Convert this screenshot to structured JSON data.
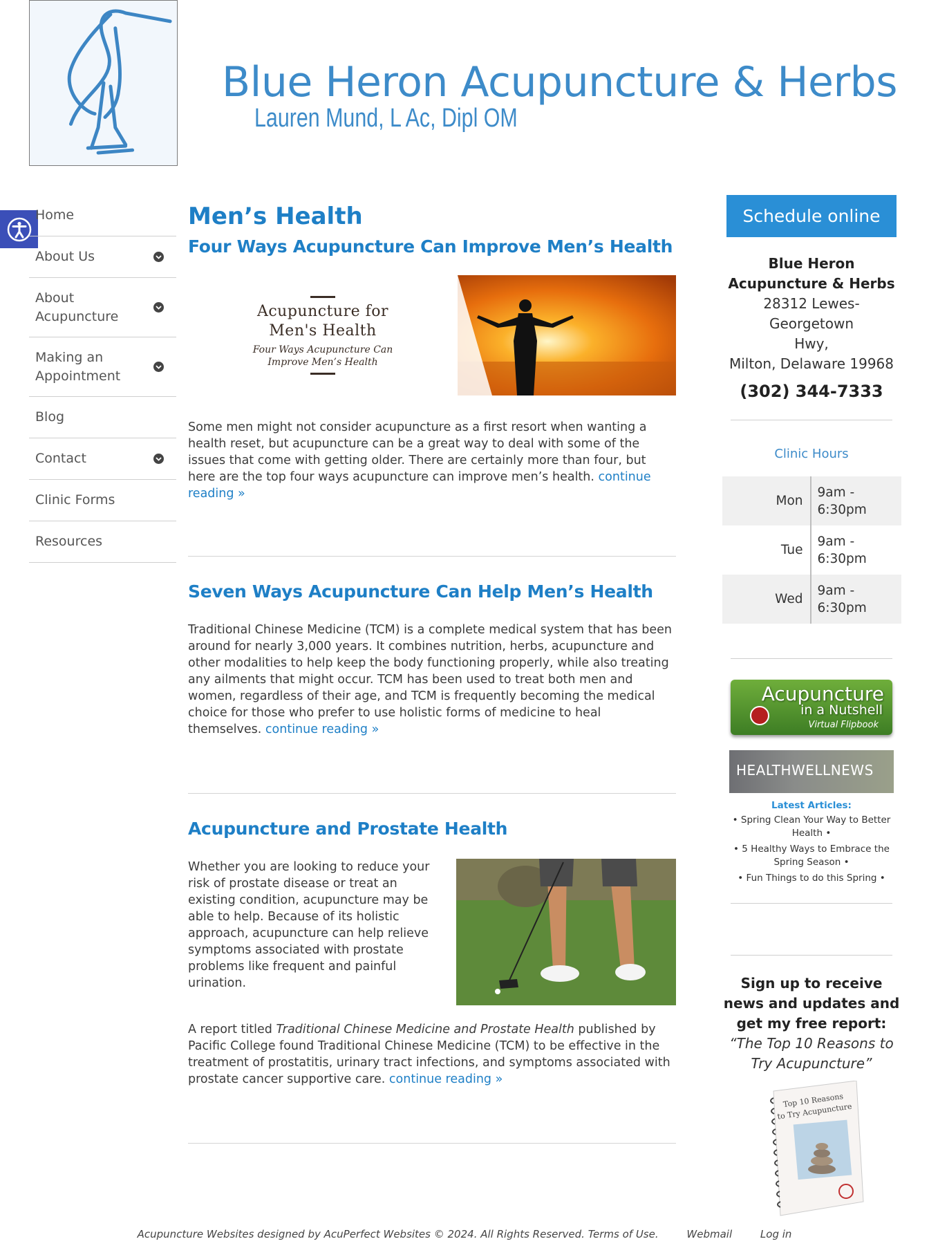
{
  "header": {
    "title": "Blue Heron Acupuncture & Herbs",
    "subtitle": "Lauren Mund, L Ac, Dipl OM"
  },
  "accessibility": {
    "icon": "accessibility-icon"
  },
  "nav": {
    "items": [
      {
        "label": "Home",
        "has_submenu": false
      },
      {
        "label": "About Us",
        "has_submenu": true
      },
      {
        "label": "About\nAcupuncture",
        "has_submenu": true
      },
      {
        "label": "Making an\nAppointment",
        "has_submenu": true
      },
      {
        "label": "Blog",
        "has_submenu": false
      },
      {
        "label": "Contact",
        "has_submenu": true
      },
      {
        "label": "Clinic Forms",
        "has_submenu": false
      },
      {
        "label": "Resources",
        "has_submenu": false
      }
    ]
  },
  "main": {
    "page_title": "Men’s Health",
    "posts": [
      {
        "title": "Four Ways Acupuncture Can Improve Men’s Health",
        "banner_heading": "Acupuncture for\nMen's Health",
        "banner_sub": "Four Ways Acupuncture Can\nImprove Men’s Health",
        "text": "Some men might not consider acupuncture as a first resort when wanting a health reset, but acupuncture can be a great way to deal with some of the issues that come with getting older. There are certainly more than four, but here are the top four ways acupuncture can improve men’s health.",
        "more": "continue reading »"
      },
      {
        "title": "Seven Ways Acupuncture Can Help Men’s Health",
        "text": "Traditional Chinese Medicine (TCM) is a complete medical system that has been around for nearly 3,000 years. It combines nutrition, herbs, acupuncture and other modalities to help keep the body functioning properly, while also treating any ailments that might occur. TCM has been used to treat both men and women, regardless of their age, and TCM is frequently becoming the medical choice for those who prefer to use holistic forms of medicine to heal themselves.",
        "more": "continue reading »"
      },
      {
        "title": "Acupuncture and Prostate Health",
        "text": "Whether you are looking to reduce your risk of prostate disease or treat an existing condition, acupuncture may be able to help. Because of its holistic approach, acupuncture can help relieve symptoms associated with prostate problems like frequent and painful urination.",
        "text2_prefix": "A report titled ",
        "text2_italic": "Traditional Chinese Medicine and Prostate Health",
        "text2_suffix": " published by Pacific College found Traditional Chinese Medicine (TCM) to be effective in the treatment of prostatitis, urinary tract infections, and symptoms associated with prostate cancer supportive care.",
        "more": "continue reading »"
      }
    ]
  },
  "sidebar": {
    "schedule_button": "Schedule online",
    "business_name": "Blue Heron\nAcupuncture & Herbs",
    "address": "28312 Lewes-Georgetown\nHwy,\nMilton, Delaware 19968",
    "phone": "(302) 344-7333",
    "hours_title": "Clinic Hours",
    "hours": [
      {
        "day": "Mon",
        "time": "9am -\n6:30pm"
      },
      {
        "day": "Tue",
        "time": "9am -\n6:30pm"
      },
      {
        "day": "Wed",
        "time": "9am -\n6:30pm"
      }
    ],
    "flipbook": {
      "line1": "Acupuncture",
      "line2": "in a Nutshell",
      "line3": "Virtual Flipbook"
    },
    "healthwell": {
      "logo_text": "HEALTHWELLNEWS",
      "latest_label": "Latest Articles:"
    },
    "articles": [
      "• Spring Clean Your Way to Better Health •",
      "• 5 Healthy Ways to Embrace the Spring Season •",
      "• Fun Things to do this Spring •"
    ],
    "signup_heading": "Sign up to receive news and updates and get my free report:",
    "report_title": "“The Top 10 Reasons to Try Acupuncture”",
    "book_text": "Top 10 Reasons\nto Try Acupuncture"
  },
  "footer": {
    "credits": "Acupuncture Websites designed by AcuPerfect Websites © 2024. All Rights Reserved. Terms of Use.",
    "webmail": "Webmail",
    "login": "Log in"
  },
  "colors": {
    "brand_blue": "#3d8bc9",
    "link_blue": "#1e7fc6",
    "button_blue": "#2a8fd6",
    "a11y_blue": "#3b4fb8"
  }
}
